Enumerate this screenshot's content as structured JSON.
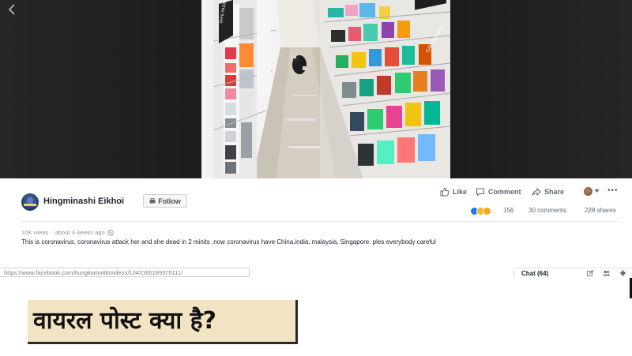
{
  "video": {
    "back_icon": "chevron-left-icon",
    "signs": [
      "SAFE PASSAGE",
      "CAR HOLDER"
    ]
  },
  "post": {
    "page_name": "Hingminashi Eikhoi",
    "follow_label": "Follow",
    "actions": {
      "like": "Like",
      "comment": "Comment",
      "share": "Share"
    },
    "reaction_count": "156",
    "comments_count": "30 comments",
    "shares_count": "228 shares",
    "views": "10K views",
    "time": "about 3 weeks ago",
    "caption": "This is coronavirus, coronavirus attack her and she dead in 2 minits ,now coronavirus have China,india, malaysia, Singapore. ples everybody careful",
    "url": "https://www.facebook.com/hungkomo88/videos/1043165189370111/",
    "chat_label": "Chat (64)"
  },
  "headline": {
    "text": "वायरल पोस्ट क्या है?"
  },
  "colors": {
    "facebook_blue": "#1877f2",
    "headline_bg": "#f1e4c3",
    "text_dark": "#1d2129",
    "text_muted": "#606770"
  }
}
